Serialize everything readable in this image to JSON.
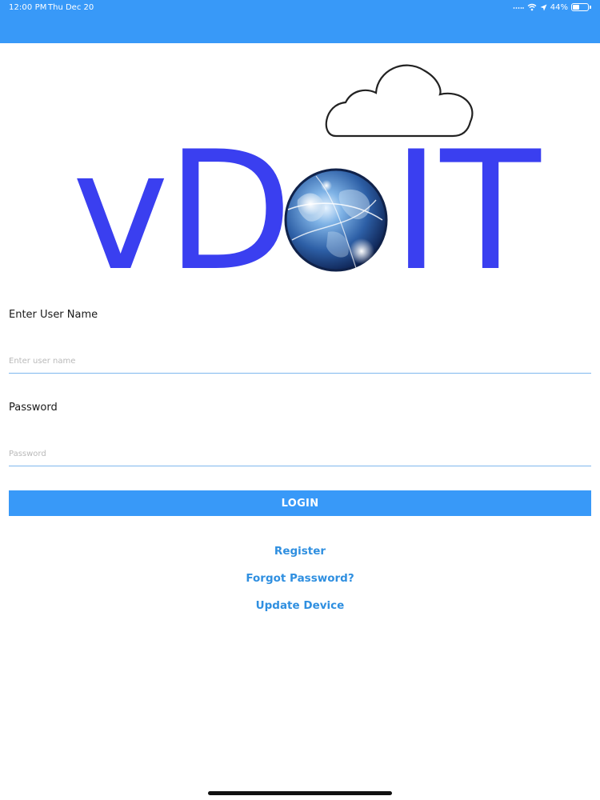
{
  "status_bar": {
    "time": "12:00 PM",
    "date": "Thu Dec 20",
    "battery_text": "44%",
    "battery_level": 0.44,
    "icons": [
      "signal-dots-icon",
      "wifi-icon",
      "location-icon",
      "battery-icon"
    ]
  },
  "logo": {
    "text_v": "v",
    "text_d": "D",
    "text_it": "IT",
    "brand_color": "#3a3ff0",
    "icons": [
      "cloud-icon",
      "globe-icon"
    ]
  },
  "form": {
    "username_label": "Enter User Name",
    "username_placeholder": "Enter user name",
    "username_value": "",
    "password_label": "Password",
    "password_placeholder": "Password",
    "password_value": "",
    "login_label": "LOGIN"
  },
  "links": {
    "register": "Register",
    "forgot_password": "Forgot Password?",
    "update_device": "Update Device"
  },
  "colors": {
    "nav_bar": "#3899f8",
    "button": "#3899f8",
    "link": "#2f8fe0",
    "input_underline": "#7fb8ee"
  }
}
